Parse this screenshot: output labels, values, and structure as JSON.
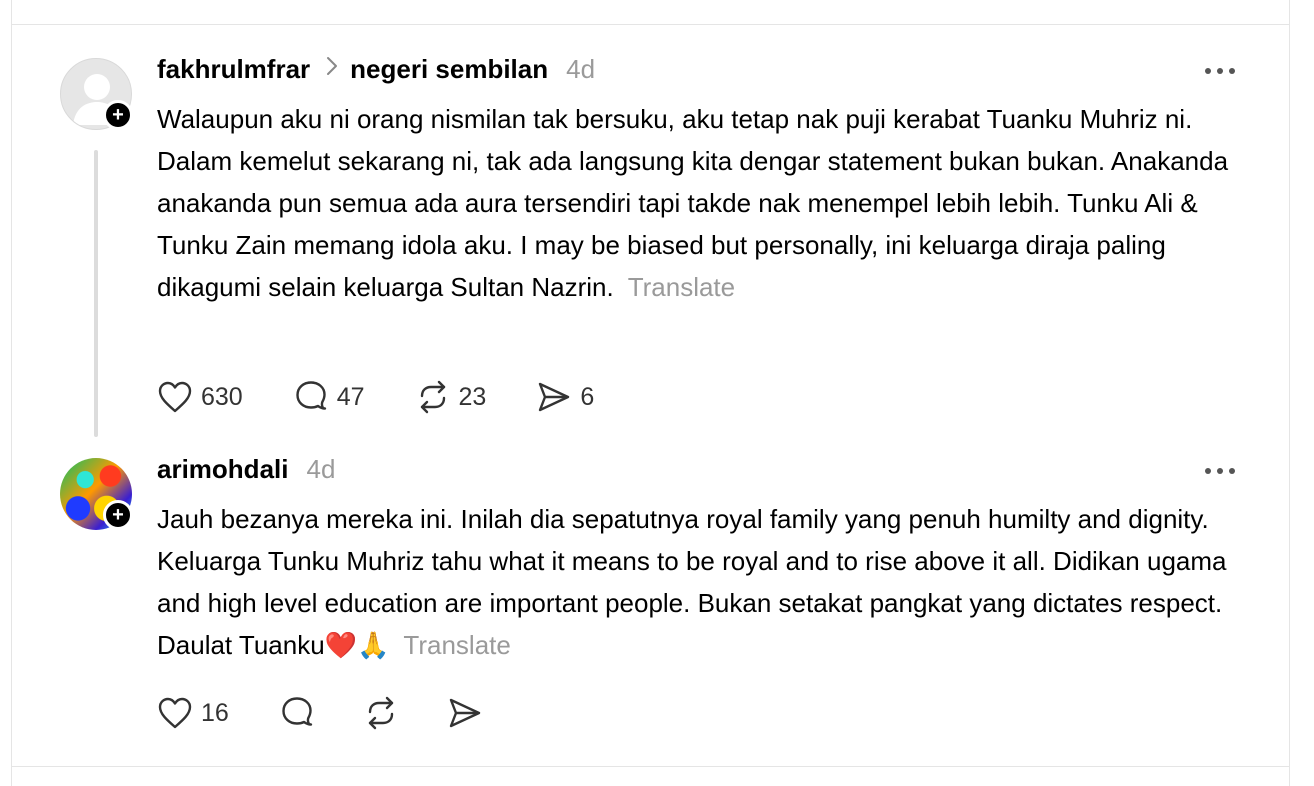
{
  "posts": [
    {
      "username": "fakhrulmfrar",
      "community": "negeri sembilan",
      "time": "4d",
      "text": "Walaupun aku ni orang nismilan tak bersuku, aku tetap nak puji kerabat Tuanku Muhriz ni. Dalam kemelut sekarang ni, tak ada langsung kita dengar statement bukan bukan. Anakanda anakanda pun semua ada aura tersendiri tapi takde nak menempel lebih lebih. Tunku Ali & Tunku Zain memang idola aku. I may be biased but personally, ini keluarga diraja paling dikagumi selain keluarga Sultan Nazrin.",
      "translate": "Translate",
      "likes": "630",
      "replies": "47",
      "reposts": "23",
      "shares": "6"
    },
    {
      "username": "arimohdali",
      "time": "4d",
      "text": "Jauh bezanya mereka ini. Inilah dia sepatutnya royal family yang penuh humilty and dignity. Keluarga Tunku Muhriz tahu what it means to be royal and to rise above it all. Didikan ugama and high level education are important people. Bukan setakat pangkat yang dictates respect. Daulat Tuanku❤️🙏",
      "translate": "Translate",
      "likes": "16"
    }
  ],
  "icons": {
    "like": "heart-icon",
    "reply": "comment-icon",
    "repost": "repost-icon",
    "share": "send-icon",
    "follow": "plus-icon",
    "more": "more-icon"
  }
}
